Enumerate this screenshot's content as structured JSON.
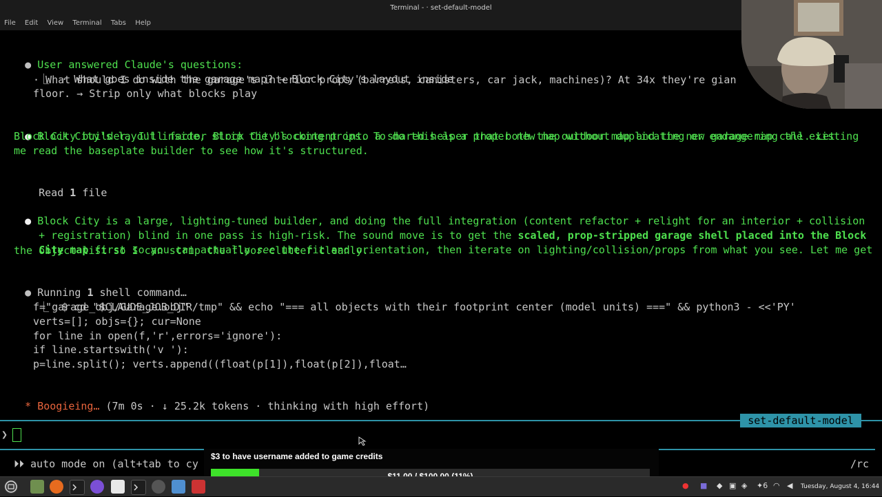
{
  "window": {
    "title": "Terminal - · set-default-model"
  },
  "menu": [
    "File",
    "Edit",
    "View",
    "Terminal",
    "Tabs",
    "Help"
  ],
  "transcript": {
    "answered": {
      "bullet": "●",
      "header": "User answered Claude's questions:",
      "tree": "⎿",
      "q1": "· What goes inside the garage map? → Block City's layout inside",
      "q2a": "· What should I do with the garage's interior props (barrels, canisters, car jack, machines)? At 34x they're gian",
      "q2b": "floor. → Strip only what blocks play"
    },
    "msg1": [
      "Block City's layout inside, strip the blocking props. To do this as a proper new map without duplicating or endangering the existing",
      "Block City builder, I'll factor Block City's content into a shared helper that both the outdoor map and the new garage map call. Let",
      "me read the baseplate builder to see how it's structured."
    ],
    "read": {
      "pre": "Read ",
      "count": "1",
      "post": " file"
    },
    "msg2": {
      "l1": "Block City is a large, lighting-tuned builder, and doing the full integration (content refactor + relight for an interior + collision",
      "l2a": "+ registration) blind in one pass is high-risk. The sound move is to get the ",
      "l2b": "scaled, prop-stripped garage shell placed into the Block",
      "l3a": "City map",
      "l3b": " first so you can actually ",
      "l3c": "see",
      "l3d": " the fit and orientation, then iterate on lighting/collision/props from what you see. Let me get",
      "l4": "the object list so I can strip the floor clutter cleanly."
    },
    "running": {
      "pre": "Running ",
      "count": "1",
      "post": " shell command…"
    },
    "cmd": [
      "$ cd \"$CLAUDE_JOB_DIR/tmp\" && echo \"=== all objects with their footprint center (model units) ===\" && python3 - <<'PY'",
      "f=\"garage_obj/Garage.obj\"",
      "verts=[]; objs={}; cur=None",
      "for line in open(f,'r',errors='ignore'):",
      "if line.startswith('v '):",
      "p=line.split(); verts.append((float(p[1]),float(p[2]),float…"
    ],
    "status": {
      "star": "*",
      "word": "Boogieing…",
      "detail": " (7m 0s · ↓ 25.2k tokens · thinking with high effort)"
    }
  },
  "session_tag": "set-default-model",
  "prompt_symbol": "❯",
  "footer": {
    "mode": "⏵⏵ auto mode on (alt+tab to cy",
    "right": "/rc"
  },
  "donation": {
    "title": "$3 to have username added to game credits",
    "progress_text": "$11.00 / $100.00 (11%)",
    "fraction": 0.11
  },
  "taskbar": {
    "clock": "Tuesday, August  4, 16:44",
    "tray_count": "6"
  },
  "colors": {
    "accent": "#2e93a8",
    "green": "#4fe04f",
    "orange": "#e8643c",
    "progress": "#3ee22a"
  }
}
